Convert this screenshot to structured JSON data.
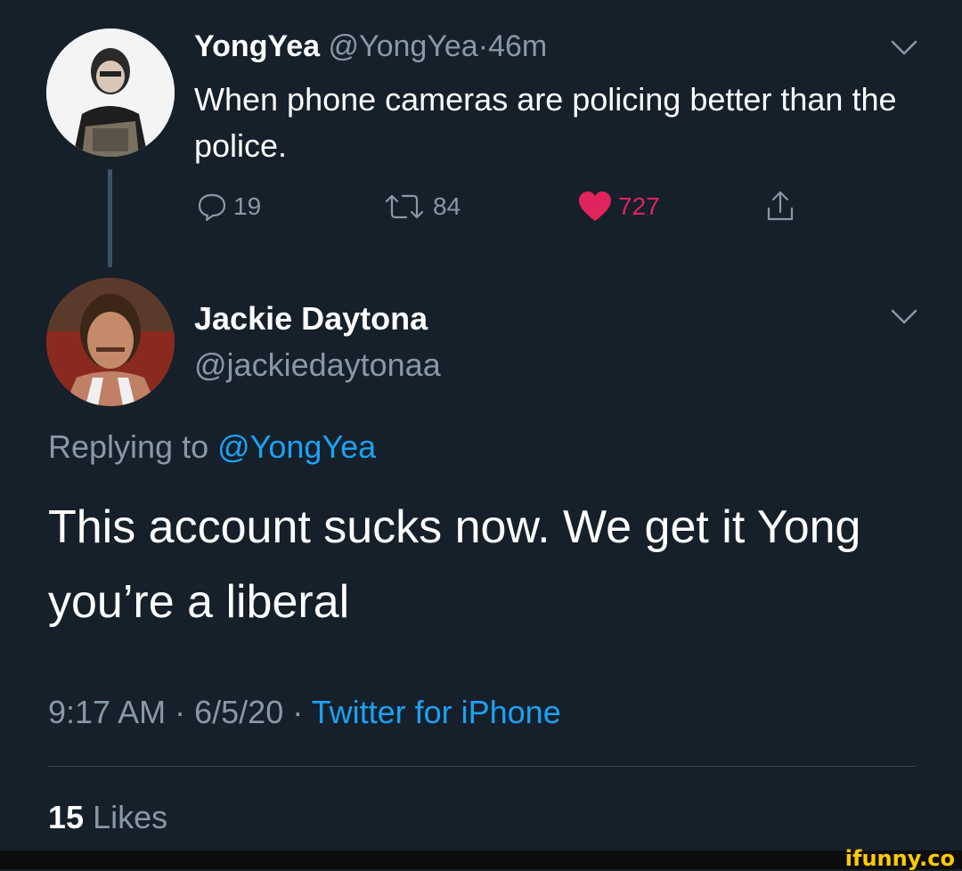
{
  "parent_tweet": {
    "display_name": "YongYea",
    "handle": "@YongYea",
    "separator": "·",
    "time_ago": "46m",
    "text": "When phone cameras are policing better than the police.",
    "replies": "19",
    "retweets": "84",
    "likes": "727"
  },
  "reply_tweet": {
    "display_name": "Jackie Daytona",
    "handle": "@jackiedaytonaa",
    "replying_prefix": "Replying to",
    "replying_to": "@YongYea",
    "text": "This account sucks now. We get it Yong you’re a liberal",
    "time": "9:17 AM",
    "date": "6/5/20",
    "separator": "·",
    "source": "Twitter for iPhone",
    "likes_count": "15",
    "likes_label": "Likes"
  },
  "watermark": "ifunny.co",
  "colors": {
    "background": "#15202b",
    "muted": "#8899a6",
    "link": "#1da1f2",
    "like": "#e0245e"
  }
}
